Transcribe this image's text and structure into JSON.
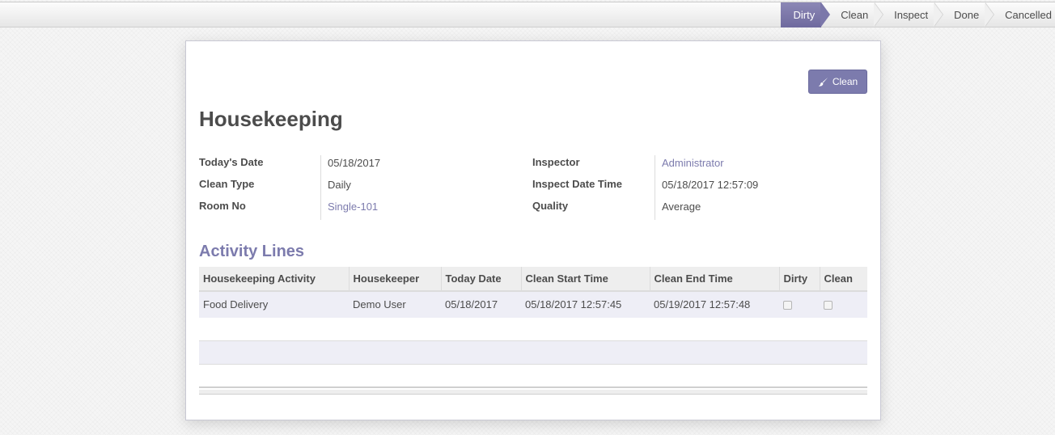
{
  "statusbar": {
    "stages": [
      "Dirty",
      "Clean",
      "Inspect",
      "Done",
      "Cancelled"
    ],
    "active": "Dirty"
  },
  "form": {
    "clean_button": "Clean",
    "title": "Housekeeping",
    "left_fields": [
      {
        "label": "Today's Date",
        "value": "05/18/2017"
      },
      {
        "label": "Clean Type",
        "value": "Daily"
      },
      {
        "label": "Room No",
        "value": "Single-101"
      }
    ],
    "right_fields": [
      {
        "label": "Inspector",
        "value": "Administrator"
      },
      {
        "label": "Inspect Date Time",
        "value": "05/18/2017 12:57:09"
      },
      {
        "label": "Quality",
        "value": "Average"
      }
    ]
  },
  "activity": {
    "title": "Activity Lines",
    "columns": [
      "Housekeeping Activity",
      "Housekeeper",
      "Today Date",
      "Clean Start Time",
      "Clean End Time",
      "Dirty",
      "Clean"
    ],
    "rows": [
      {
        "activity": "Food Delivery",
        "housekeeper": "Demo User",
        "today_date": "05/18/2017",
        "clean_start": "05/18/2017 12:57:45",
        "clean_end": "05/19/2017 12:57:48",
        "dirty": false,
        "clean": false
      }
    ]
  },
  "colors": {
    "accent": "#7c7bad",
    "active_stage": "#7b77aa"
  },
  "icons": {
    "clean_button_icon": "brush-icon"
  }
}
